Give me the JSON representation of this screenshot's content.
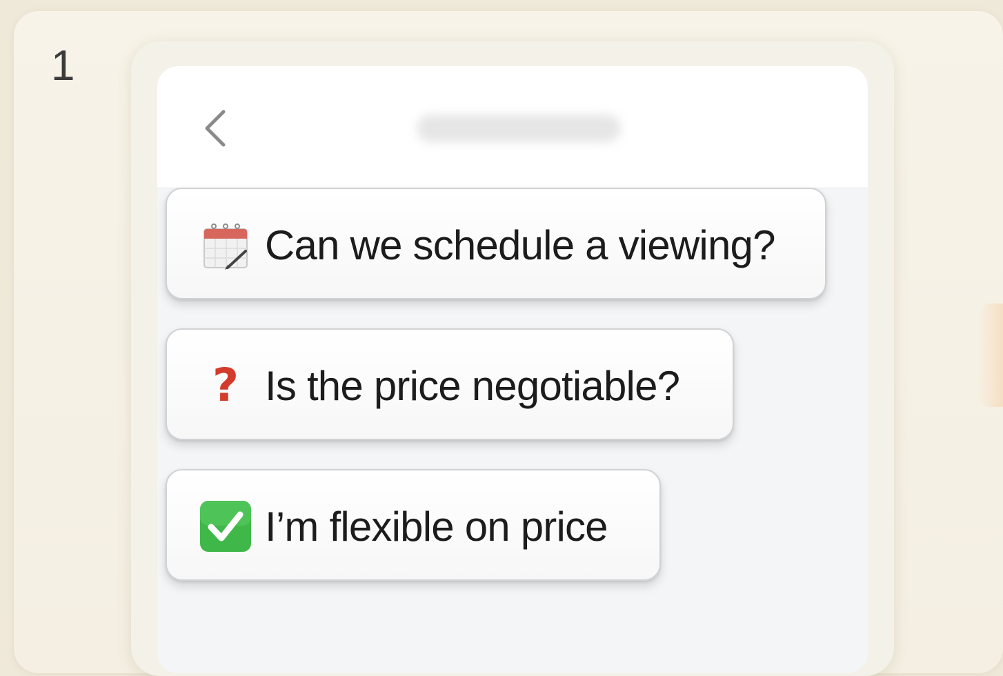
{
  "step": {
    "number": "1"
  },
  "header": {
    "back_icon": "chevron-left-icon",
    "title": ""
  },
  "quick_replies": [
    {
      "label": "Can we schedule a viewing?",
      "icon": "calendar-icon"
    },
    {
      "label": "Is the price negotiable?",
      "icon": "question-mark-icon",
      "icon_color": "#d33b2c"
    },
    {
      "label": "I’m flexible on price",
      "icon": "check-mark-button-icon",
      "icon_color": "#3fb849"
    }
  ],
  "colors": {
    "background": "#efe9da",
    "screen": "#f4f5f6",
    "text": "#1c1c1c"
  }
}
